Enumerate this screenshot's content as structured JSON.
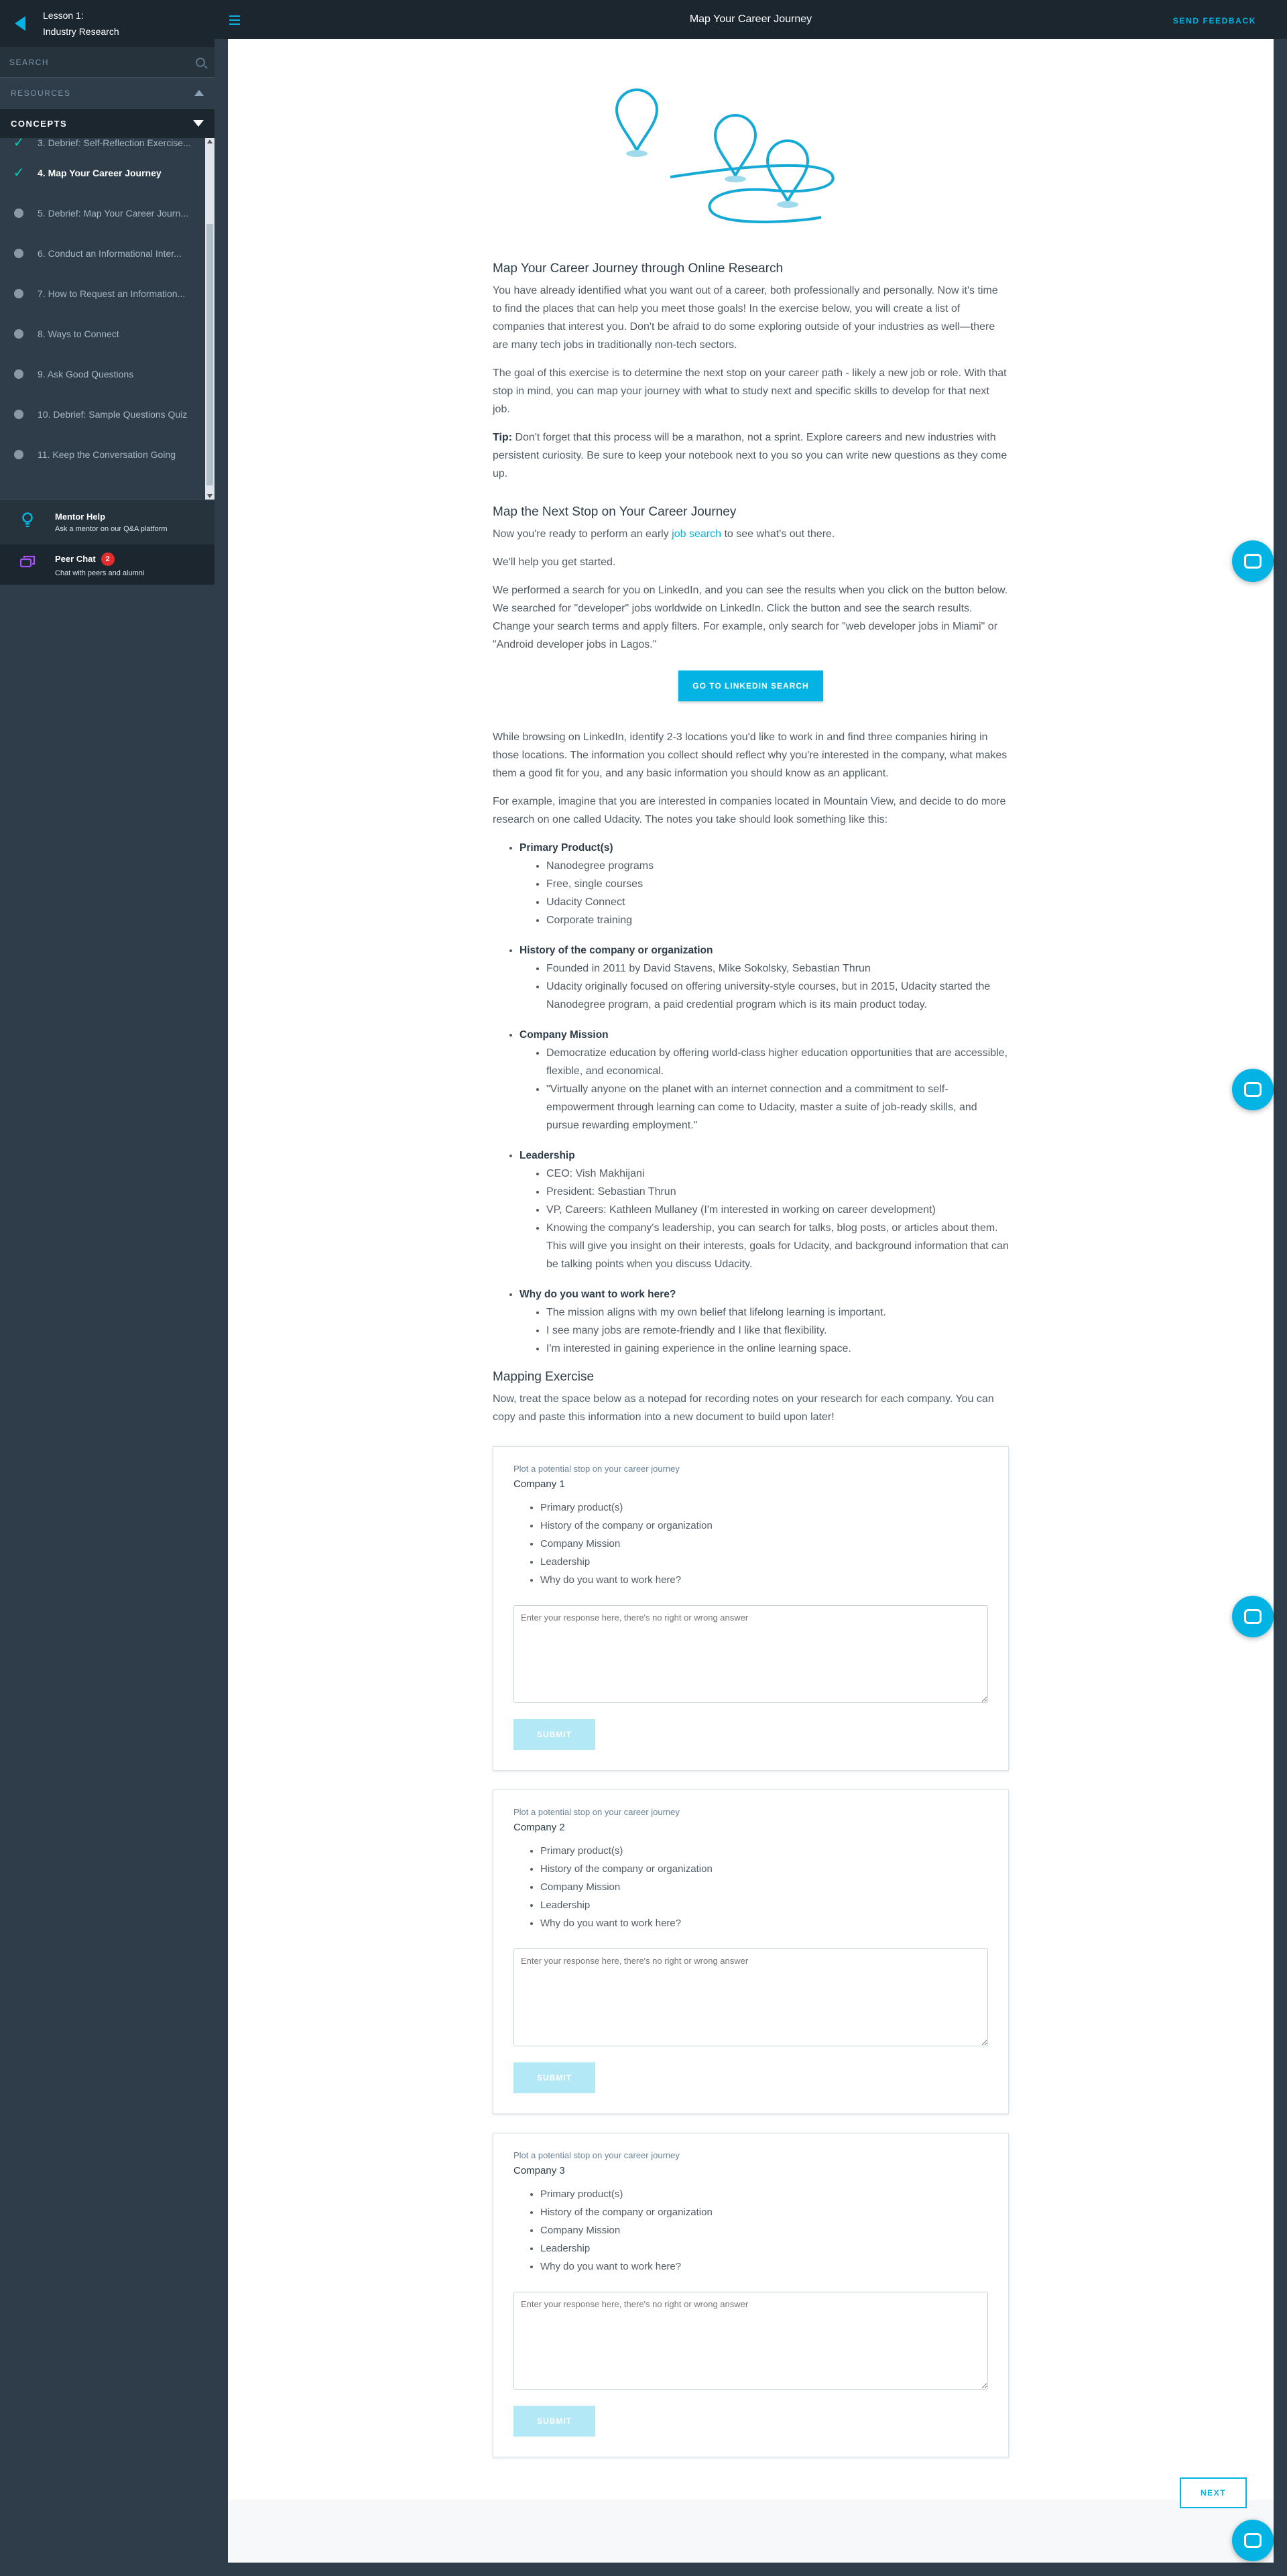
{
  "colors": {
    "accent": "#02b3e4",
    "sidebar": "#2e3d49",
    "check": "#02ccba",
    "badge": "#e32c2c"
  },
  "sidebar": {
    "lesson_line1": "Lesson 1:",
    "lesson_line2": "Industry Research",
    "search_label": "SEARCH",
    "resources_label": "RESOURCES",
    "concepts_label": "CONCEPTS",
    "concepts": [
      {
        "label": "3. Debrief: Self-Reflection Exercise...",
        "state": "done"
      },
      {
        "label": "4. Map Your Career Journey",
        "state": "active"
      },
      {
        "label": "5. Debrief: Map Your Career Journ...",
        "state": "todo"
      },
      {
        "label": "6. Conduct an Informational Inter...",
        "state": "todo"
      },
      {
        "label": "7. How to Request an Information...",
        "state": "todo"
      },
      {
        "label": "8. Ways to Connect",
        "state": "todo"
      },
      {
        "label": "9. Ask Good Questions",
        "state": "todo"
      },
      {
        "label": "10. Debrief: Sample Questions Quiz",
        "state": "todo"
      },
      {
        "label": "11. Keep the Conversation Going",
        "state": "todo"
      }
    ],
    "mentor_title": "Mentor Help",
    "mentor_sub": "Ask a mentor on our Q&A platform",
    "peer_title": "Peer Chat",
    "peer_count": "2",
    "peer_sub": "Chat with peers and alumni"
  },
  "topbar": {
    "title": "Map Your Career Journey",
    "feedback": "SEND FEEDBACK"
  },
  "content": {
    "h1": "Map Your Career Journey through Online Research",
    "p1": "You have already identified what you want out of a career, both professionally and personally. Now it's time to find the places that can help you meet those goals! In the exercise below, you will create a list of companies that interest you. Don't be afraid to do some exploring outside of your industries as well—there are many tech jobs in traditionally non-tech sectors.",
    "p2": "The goal of this exercise is to determine the next stop on your career path - likely a new job or role. With that stop in mind, you can map your journey with what to study next and specific skills to develop for that next job.",
    "tip_label": "Tip:",
    "tip_text": " Don't forget that this process will be a marathon, not a sprint. Explore careers and new industries with persistent curiosity. Be sure to keep your notebook next to you so you can write new questions as they come up.",
    "h2": "Map the Next Stop on Your Career Journey",
    "p3_a": "Now you're ready to perform an early ",
    "p3_link": "job search",
    "p3_b": " to see what's out there.",
    "p4": "We'll help you get started.",
    "p5": "We performed a search for you on LinkedIn, and you can see the results when you click on the button below. We searched for \"developer\" jobs worldwide on LinkedIn. Click the button and see the search results. Change your search terms and apply filters. For example, only search for \"web developer jobs in Miami\" or \"Android developer jobs in Lagos.\"",
    "linkedin_btn": "GO TO LINKEDIN SEARCH",
    "p6": "While browsing on LinkedIn, identify 2-3 locations you'd like to work in and find three companies hiring in those locations. The information you collect should reflect why you're interested in the company, what makes them a good fit for you, and any basic information you should know as an applicant.",
    "p7": "For example, imagine that you are interested in companies located in Mountain View, and decide to do more research on one called Udacity. The notes you take should look something like this:",
    "example": [
      {
        "title": "Primary Product(s)",
        "items": [
          "Nanodegree programs",
          "Free, single courses",
          "Udacity Connect",
          "Corporate training"
        ]
      },
      {
        "title": "History of the company or organization",
        "items": [
          "Founded in 2011 by David Stavens, Mike Sokolsky, Sebastian Thrun",
          "Udacity originally focused on offering university-style courses, but in 2015, Udacity started the Nanodegree program, a paid credential program which is its main product today."
        ]
      },
      {
        "title": "Company Mission",
        "items": [
          "Democratize education by offering world-class higher education opportunities that are accessible, flexible, and economical.",
          "\"Virtually anyone on the planet with an internet connection and a commitment to self-empowerment through learning can come to Udacity, master a suite of job-ready skills, and pursue rewarding employment.\""
        ]
      },
      {
        "title": "Leadership",
        "items": [
          "CEO: Vish Makhijani",
          "President: Sebastian Thrun",
          "VP, Careers: Kathleen Mullaney (I'm interested in working on career development)",
          "Knowing the company's leadership, you can search for talks, blog posts, or articles about them. This will give you insight on their interests, goals for Udacity, and background information that can be talking points when you discuss Udacity."
        ]
      },
      {
        "title": "Why do you want to work here?",
        "items": [
          "The mission aligns with my own belief that lifelong learning is important.",
          "I see many jobs are remote-friendly and I like that flexibility.",
          "I'm interested in gaining experience in the online learning space."
        ]
      }
    ],
    "h3": "Mapping Exercise",
    "p8": "Now, treat the space below as a notepad for recording notes on your research for each company. You can copy and paste this information into a new document to build upon later!",
    "cards": [
      {
        "label": "Plot a potential stop on your career journey",
        "company": "Company 1"
      },
      {
        "label": "Plot a potential stop on your career journey",
        "company": "Company 2"
      },
      {
        "label": "Plot a potential stop on your career journey",
        "company": "Company 3"
      }
    ],
    "card_items": [
      "Primary product(s)",
      "History of the company or organization",
      "Company Mission",
      "Leadership",
      "Why do you want to work here?"
    ],
    "placeholder": "Enter your response here, there's no right or wrong answer",
    "submit": "SUBMIT"
  },
  "next_label": "NEXT"
}
